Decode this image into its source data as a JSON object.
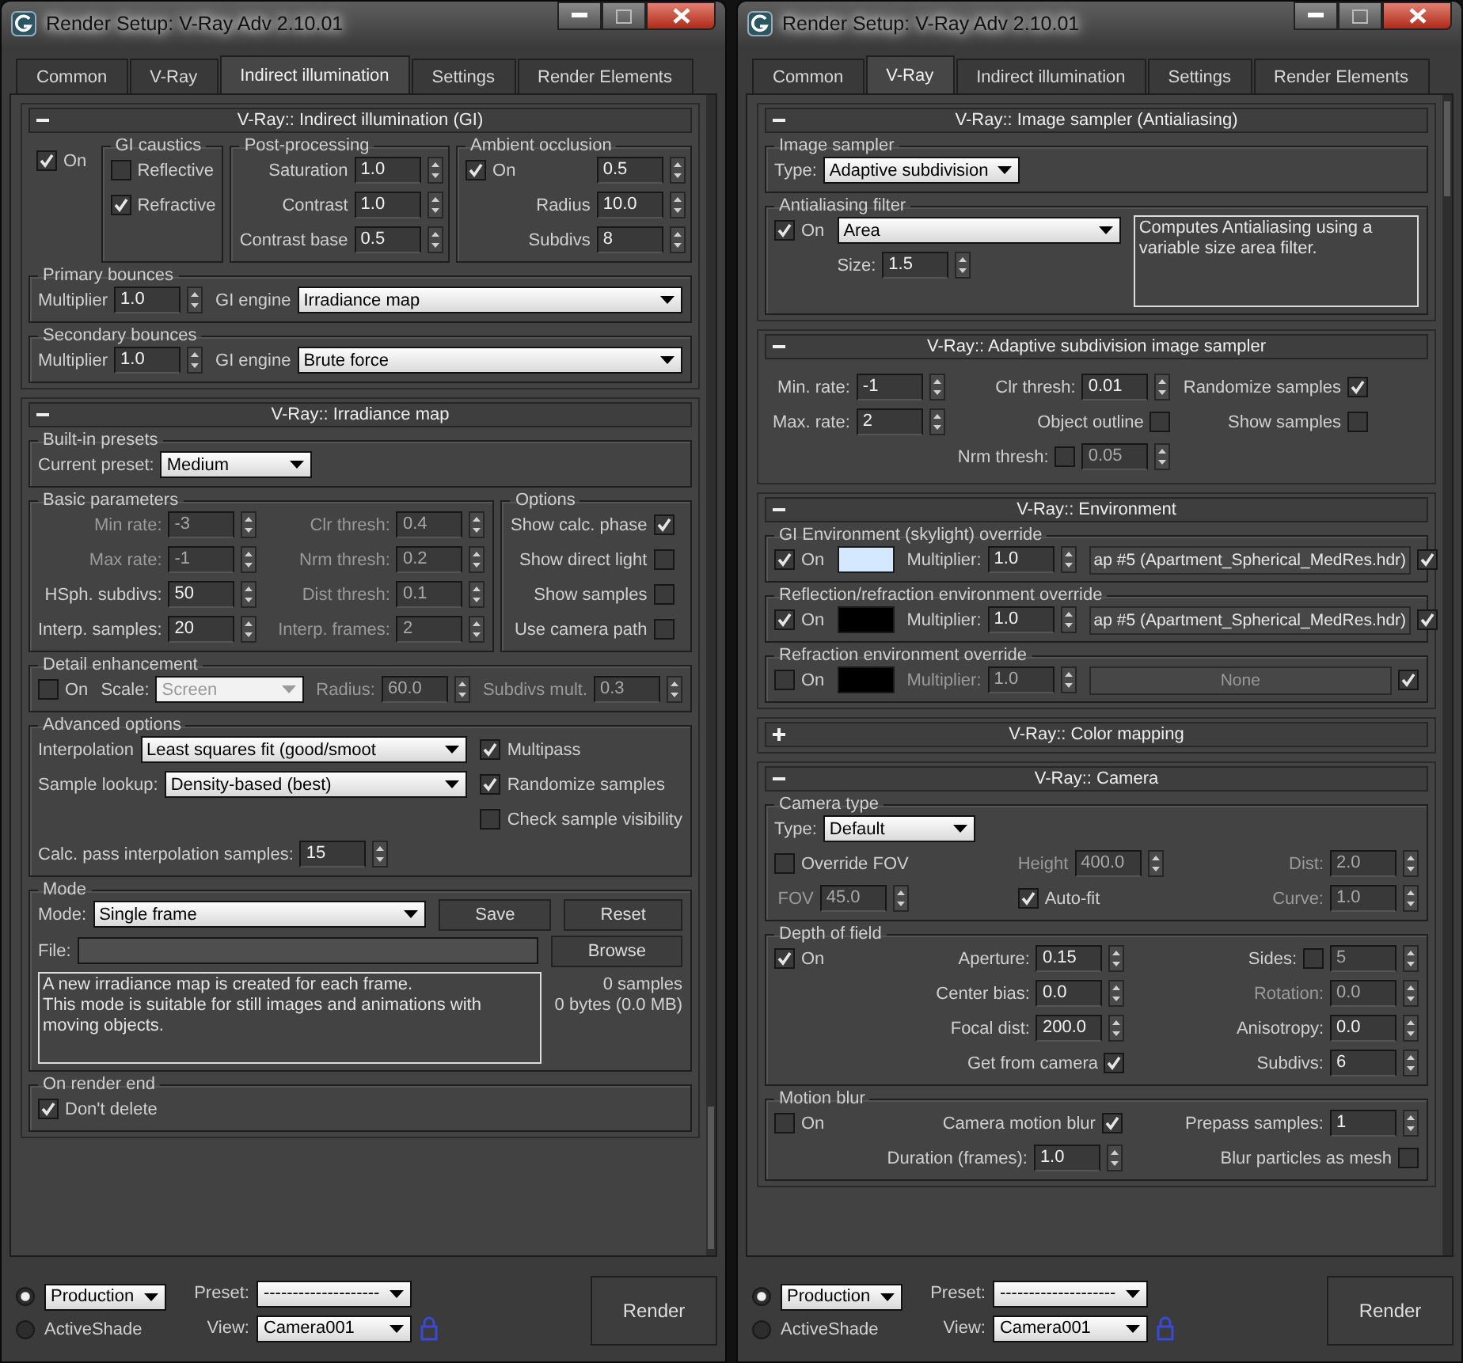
{
  "windows": [
    {
      "title": "Render Setup: V-Ray Adv 2.10.01",
      "tabs": [
        {
          "label": "Common",
          "selected": false
        },
        {
          "label": "V-Ray",
          "selected": false
        },
        {
          "label": "Indirect illumination",
          "selected": true
        },
        {
          "label": "Settings",
          "selected": false
        },
        {
          "label": "Render Elements",
          "selected": false
        }
      ],
      "rollouts": [
        {
          "title": "V-Ray:: Indirect illumination (GI)",
          "expanded": true,
          "group_rows": [
            [
              {
                "blocks": [
                  {
                    "columns": [
                      [
                        {
                          "kind": "check",
                          "label": "On",
                          "checked": true
                        }
                      ]
                    ]
                  }
                ]
              },
              {
                "label": "GI caustics",
                "blocks": [
                  {
                    "columns": [
                      [
                        {
                          "kind": "check",
                          "label": "Reflective",
                          "checked": false
                        },
                        {
                          "kind": "check",
                          "label": "Refractive",
                          "checked": true
                        }
                      ]
                    ]
                  }
                ]
              },
              {
                "label": "Post-processing",
                "blocks": [
                  {
                    "columns": [
                      [
                        {
                          "kind": "spinner",
                          "label": "Saturation",
                          "value": "1.0"
                        },
                        {
                          "kind": "spinner",
                          "label": "Contrast",
                          "value": "1.0"
                        },
                        {
                          "kind": "spinner",
                          "label": "Contrast base",
                          "value": "0.5"
                        }
                      ]
                    ]
                  }
                ]
              },
              {
                "label": "Ambient occlusion",
                "blocks": [
                  {
                    "columns": [
                      [
                        {
                          "kind": "check",
                          "label": "On",
                          "checked": true
                        }
                      ],
                      [
                        {
                          "kind": "spinner",
                          "value": "0.5"
                        },
                        {
                          "kind": "spinner",
                          "label": "Radius",
                          "value": "10.0"
                        },
                        {
                          "kind": "spinner",
                          "label": "Subdivs",
                          "value": "8"
                        }
                      ]
                    ]
                  }
                ]
              }
            ],
            [
              {
                "label": "Primary bounces",
                "blocks": [
                  {
                    "columns": [
                      [
                        {
                          "kind": "spinner",
                          "label": "Multiplier",
                          "value": "1.0"
                        }
                      ],
                      [
                        {
                          "kind": "dropdown",
                          "label": "GI engine",
                          "value": "Irradiance map"
                        }
                      ]
                    ]
                  }
                ]
              }
            ],
            [
              {
                "label": "Secondary bounces",
                "blocks": [
                  {
                    "columns": [
                      [
                        {
                          "kind": "spinner",
                          "label": "Multiplier",
                          "value": "1.0"
                        }
                      ],
                      [
                        {
                          "kind": "dropdown",
                          "label": "GI engine",
                          "value": "Brute force"
                        }
                      ]
                    ]
                  }
                ]
              }
            ]
          ]
        },
        {
          "title": "V-Ray:: Irradiance map",
          "expanded": true,
          "group_rows": [
            [
              {
                "label": "Built-in presets",
                "blocks": [
                  {
                    "columns": [
                      [
                        {
                          "kind": "dropdown",
                          "label": "Current preset:",
                          "value": "Medium"
                        }
                      ]
                    ]
                  }
                ]
              }
            ],
            [
              {
                "label": "Basic parameters",
                "blocks": [
                  {
                    "columns": [
                      [
                        {
                          "kind": "spinner",
                          "label": "Min rate:",
                          "value": "-3",
                          "disabled": true
                        },
                        {
                          "kind": "spinner",
                          "label": "Max rate:",
                          "value": "-1",
                          "disabled": true
                        },
                        {
                          "kind": "spinner",
                          "label": "HSph. subdivs:",
                          "value": "50"
                        },
                        {
                          "kind": "spinner",
                          "label": "Interp. samples:",
                          "value": "20"
                        }
                      ],
                      [
                        {
                          "kind": "spinner",
                          "label": "Clr thresh:",
                          "value": "0.4",
                          "disabled": true
                        },
                        {
                          "kind": "spinner",
                          "label": "Nrm thresh:",
                          "value": "0.2",
                          "disabled": true
                        },
                        {
                          "kind": "spinner",
                          "label": "Dist thresh:",
                          "value": "0.1",
                          "disabled": true
                        },
                        {
                          "kind": "spinner",
                          "label": "Interp. frames:",
                          "value": "2",
                          "disabled": true
                        }
                      ]
                    ]
                  }
                ]
              },
              {
                "label": "Options",
                "blocks": [
                  {
                    "columns": [
                      [
                        {
                          "kind": "check_right",
                          "label": "Show calc. phase",
                          "checked": true
                        },
                        {
                          "kind": "check_right",
                          "label": "Show direct light",
                          "checked": false
                        },
                        {
                          "kind": "check_right",
                          "label": "Show samples",
                          "checked": false
                        },
                        {
                          "kind": "check_right",
                          "label": "Use camera path",
                          "checked": false
                        }
                      ]
                    ]
                  }
                ]
              }
            ],
            [
              {
                "label": "Detail enhancement",
                "blocks": [
                  {
                    "columns": [
                      [
                        {
                          "kind": "check",
                          "label": "On",
                          "checked": false
                        }
                      ],
                      [
                        {
                          "kind": "dropdown",
                          "label": "Scale:",
                          "value": "Screen",
                          "disabled": true
                        }
                      ],
                      [
                        {
                          "kind": "spinner",
                          "label": "Radius:",
                          "value": "60.0",
                          "disabled": true
                        }
                      ],
                      [
                        {
                          "kind": "spinner",
                          "label": "Subdivs mult.",
                          "value": "0.3",
                          "disabled": true
                        }
                      ]
                    ]
                  }
                ]
              }
            ],
            [
              {
                "label": "Advanced options",
                "blocks": [
                  {
                    "columns": [
                      [
                        {
                          "kind": "dropdown",
                          "label": "Interpolation",
                          "value": "Least squares fit (good/smoot"
                        },
                        {
                          "kind": "dropdown",
                          "label": "Sample lookup:",
                          "value": "Density-based (best)"
                        }
                      ],
                      [
                        {
                          "kind": "check",
                          "label": "Multipass",
                          "checked": true
                        },
                        {
                          "kind": "check",
                          "label": "Randomize samples",
                          "checked": true
                        },
                        {
                          "kind": "check",
                          "label": "Check sample visibility",
                          "checked": false
                        }
                      ]
                    ]
                  },
                  {
                    "columns": [
                      [
                        {
                          "kind": "spinner",
                          "label": "Calc. pass interpolation samples:",
                          "value": "15"
                        }
                      ]
                    ]
                  }
                ]
              }
            ],
            [
              {
                "label": "Mode",
                "blocks": [
                  {
                    "columns": [
                      [
                        {
                          "kind": "dropdown",
                          "label": "Mode:",
                          "value": "Single frame"
                        }
                      ],
                      [
                        {
                          "kind": "button",
                          "label": "Save"
                        }
                      ],
                      [
                        {
                          "kind": "button",
                          "label": "Reset"
                        }
                      ]
                    ]
                  },
                  {
                    "columns": [
                      [
                        {
                          "kind": "field",
                          "label": "File:"
                        }
                      ],
                      [
                        {
                          "kind": "button",
                          "label": "Browse"
                        }
                      ]
                    ]
                  },
                  {
                    "columns": [
                      [
                        {
                          "kind": "note",
                          "text": "A new irradiance map is created for each frame.\nThis mode is suitable for still images and animations with moving objects."
                        }
                      ],
                      [
                        {
                          "kind": "stats",
                          "lines": [
                            "0 samples",
                            "0 bytes (0.0 MB)"
                          ]
                        }
                      ]
                    ]
                  }
                ]
              }
            ],
            [
              {
                "label": "On render end",
                "blocks": [
                  {
                    "columns": [
                      [
                        {
                          "kind": "check",
                          "label": "Don't delete",
                          "checked": true
                        }
                      ]
                    ]
                  }
                ]
              }
            ]
          ]
        }
      ],
      "bottom": {
        "modes": [
          {
            "kind": "dropdown",
            "value": "Production",
            "selected": true
          },
          {
            "kind": "label",
            "value": "ActiveShade",
            "selected": false
          }
        ],
        "preset_label": "Preset:",
        "preset_value": "--------------------",
        "view_label": "View:",
        "view_value": "Camera001",
        "render_button": "Render"
      }
    },
    {
      "title": "Render Setup: V-Ray Adv 2.10.01",
      "tabs": [
        {
          "label": "Common",
          "selected": false
        },
        {
          "label": "V-Ray",
          "selected": true
        },
        {
          "label": "Indirect illumination",
          "selected": false
        },
        {
          "label": "Settings",
          "selected": false
        },
        {
          "label": "Render Elements",
          "selected": false
        }
      ],
      "rollouts": [
        {
          "title": "V-Ray:: Image sampler (Antialiasing)",
          "expanded": true,
          "group_rows": [
            [
              {
                "label": "Image sampler",
                "blocks": [
                  {
                    "columns": [
                      [
                        {
                          "kind": "dropdown",
                          "label": "Type:",
                          "value": "Adaptive subdivision"
                        }
                      ]
                    ]
                  }
                ]
              }
            ],
            [
              {
                "label": "Antialiasing filter",
                "blocks": [
                  {
                    "columns": [
                      [
                        {
                          "kind": "check",
                          "label": "On",
                          "checked": true
                        }
                      ],
                      [
                        {
                          "kind": "dropdown",
                          "value": "Area"
                        },
                        {
                          "kind": "spinner",
                          "label": "Size:",
                          "value": "1.5"
                        }
                      ],
                      [
                        {
                          "kind": "note",
                          "text": "Computes Antialiasing using a variable size area filter."
                        }
                      ]
                    ]
                  }
                ]
              }
            ]
          ]
        },
        {
          "title": "V-Ray:: Adaptive subdivision image sampler",
          "expanded": true,
          "group_rows": [
            [
              {
                "blocks": [
                  {
                    "columns": [
                      [
                        {
                          "kind": "spinner",
                          "label": "Min. rate:",
                          "value": "-1"
                        },
                        {
                          "kind": "spinner",
                          "label": "Max. rate:",
                          "value": "2"
                        }
                      ],
                      [
                        {
                          "kind": "spinner",
                          "label": "Clr thresh:",
                          "value": "0.01"
                        },
                        {
                          "kind": "check_right",
                          "label": "Object outline",
                          "checked": false
                        },
                        {
                          "kind": "check_spinner",
                          "label": "Nrm thresh:",
                          "checked": false,
                          "value": "0.05",
                          "disabled": true
                        }
                      ],
                      [
                        {
                          "kind": "check_right",
                          "label": "Randomize samples",
                          "checked": true
                        },
                        {
                          "kind": "check_right",
                          "label": "Show samples",
                          "checked": false
                        }
                      ]
                    ]
                  }
                ]
              }
            ]
          ]
        },
        {
          "title": "V-Ray:: Environment",
          "expanded": true,
          "group_rows": [
            [
              {
                "label": "GI Environment (skylight) override",
                "blocks": [
                  {
                    "columns": [
                      [
                        {
                          "kind": "check",
                          "label": "On",
                          "checked": true
                        }
                      ],
                      [
                        {
                          "kind": "swatch",
                          "color": "#d4e8ff"
                        }
                      ],
                      [
                        {
                          "kind": "spinner",
                          "label": "Multiplier:",
                          "value": "1.0"
                        }
                      ],
                      [
                        {
                          "kind": "map",
                          "value": "ap #5 (Apartment_Spherical_MedRes.hdr)",
                          "checked": true
                        }
                      ]
                    ]
                  }
                ]
              }
            ],
            [
              {
                "label": "Reflection/refraction environment override",
                "blocks": [
                  {
                    "columns": [
                      [
                        {
                          "kind": "check",
                          "label": "On",
                          "checked": true
                        }
                      ],
                      [
                        {
                          "kind": "swatch",
                          "color": "#000000"
                        }
                      ],
                      [
                        {
                          "kind": "spinner",
                          "label": "Multiplier:",
                          "value": "1.0"
                        }
                      ],
                      [
                        {
                          "kind": "map",
                          "value": "ap #5 (Apartment_Spherical_MedRes.hdr)",
                          "checked": true
                        }
                      ]
                    ]
                  }
                ]
              }
            ],
            [
              {
                "label": "Refraction environment override",
                "blocks": [
                  {
                    "columns": [
                      [
                        {
                          "kind": "check",
                          "label": "On",
                          "checked": false
                        }
                      ],
                      [
                        {
                          "kind": "swatch",
                          "color": "#000000"
                        }
                      ],
                      [
                        {
                          "kind": "spinner",
                          "label": "Multiplier:",
                          "value": "1.0",
                          "disabled": true
                        }
                      ],
                      [
                        {
                          "kind": "map",
                          "value": "None",
                          "checked": true,
                          "disabled": true
                        }
                      ]
                    ]
                  }
                ]
              }
            ]
          ]
        },
        {
          "title": "V-Ray:: Color mapping",
          "expanded": false
        },
        {
          "title": "V-Ray:: Camera",
          "expanded": true,
          "group_rows": [
            [
              {
                "label": "Camera type",
                "blocks": [
                  {
                    "columns": [
                      [
                        {
                          "kind": "dropdown",
                          "label": "Type:",
                          "value": "Default"
                        }
                      ]
                    ]
                  },
                  {
                    "columns": [
                      [
                        {
                          "kind": "check",
                          "label": "Override FOV",
                          "checked": false
                        },
                        {
                          "kind": "spinner",
                          "label": "FOV",
                          "value": "45.0",
                          "disabled": true
                        }
                      ],
                      [
                        {
                          "kind": "spinner",
                          "label": "Height",
                          "value": "400.0",
                          "disabled": true
                        },
                        {
                          "kind": "check",
                          "label": "Auto-fit",
                          "checked": true
                        }
                      ],
                      [
                        {
                          "kind": "spinner",
                          "label": "Dist:",
                          "value": "2.0",
                          "disabled": true
                        },
                        {
                          "kind": "spinner",
                          "label": "Curve:",
                          "value": "1.0",
                          "disabled": true
                        }
                      ]
                    ]
                  }
                ]
              }
            ],
            [
              {
                "label": "Depth of field",
                "blocks": [
                  {
                    "columns": [
                      [
                        {
                          "kind": "check",
                          "label": "On",
                          "checked": true
                        }
                      ],
                      [
                        {
                          "kind": "spinner",
                          "label": "Aperture:",
                          "value": "0.15"
                        },
                        {
                          "kind": "spinner",
                          "label": "Center bias:",
                          "value": "0.0"
                        },
                        {
                          "kind": "spinner",
                          "label": "Focal dist:",
                          "value": "200.0"
                        },
                        {
                          "kind": "check_right",
                          "label": "Get from camera",
                          "checked": true
                        }
                      ],
                      [
                        {
                          "kind": "check_spinner",
                          "label": "Sides:",
                          "checked": false,
                          "value": "5",
                          "disabled": true
                        },
                        {
                          "kind": "spinner",
                          "label": "Rotation:",
                          "value": "0.0",
                          "disabled": true
                        },
                        {
                          "kind": "spinner",
                          "label": "Anisotropy:",
                          "value": "0.0"
                        },
                        {
                          "kind": "spinner",
                          "label": "Subdivs:",
                          "value": "6"
                        }
                      ]
                    ]
                  }
                ]
              }
            ],
            [
              {
                "label": "Motion blur",
                "blocks": [
                  {
                    "columns": [
                      [
                        {
                          "kind": "check",
                          "label": "On",
                          "checked": false
                        }
                      ],
                      [
                        {
                          "kind": "check_right",
                          "label": "Camera motion blur",
                          "checked": true
                        },
                        {
                          "kind": "spinner",
                          "label": "Duration (frames):",
                          "value": "1.0"
                        }
                      ],
                      [
                        {
                          "kind": "spinner",
                          "label": "Prepass samples:",
                          "value": "1"
                        },
                        {
                          "kind": "check_right",
                          "label": "Blur particles as mesh",
                          "checked": false
                        }
                      ]
                    ]
                  }
                ]
              }
            ]
          ]
        }
      ],
      "bottom": {
        "modes": [
          {
            "kind": "dropdown",
            "value": "Production",
            "selected": true
          },
          {
            "kind": "label",
            "value": "ActiveShade",
            "selected": false
          }
        ],
        "preset_label": "Preset:",
        "preset_value": "--------------------",
        "view_label": "View:",
        "view_value": "Camera001",
        "render_button": "Render"
      }
    }
  ]
}
